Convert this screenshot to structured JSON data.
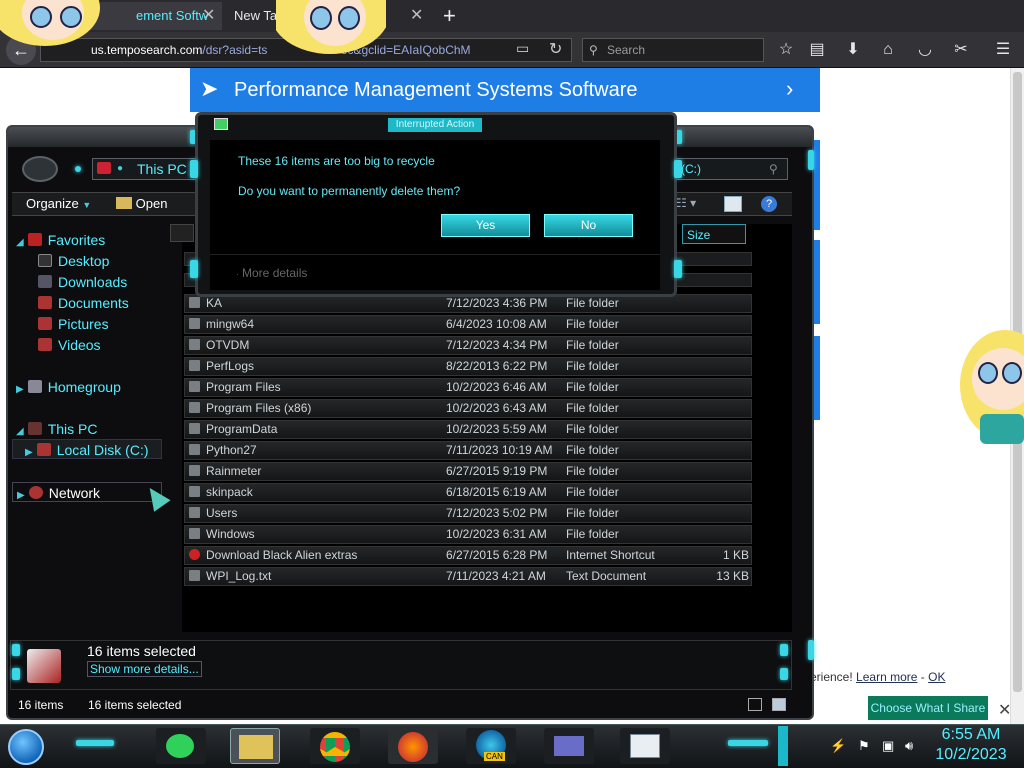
{
  "browser": {
    "tabs": [
      {
        "label": "ement Softw"
      },
      {
        "label": "New Tab"
      }
    ],
    "new_tab_icon": "plus-icon",
    "url_prefix": "https://",
    "url_domain": "us.temposearch.com",
    "url_rest": "/dsr?asid=ts",
    "url_tail": "ec&gclid=EAIaIQobChM",
    "search_placeholder": "Search"
  },
  "webpage": {
    "banner_title": "Performance Management Systems Software",
    "notice_text": "erience!",
    "learn_more": "Learn more",
    "separator": "-",
    "ok": "OK",
    "share_button": "Choose What I Share",
    "accent": "#1e7ee6"
  },
  "explorer": {
    "address_label": "This PC",
    "address_right": "(C:)",
    "toolbar": {
      "organize": "Organize",
      "open": "Open"
    },
    "column_size": "Size",
    "nav": {
      "favorites": "Favorites",
      "desktop": "Desktop",
      "downloads": "Downloads",
      "documents": "Documents",
      "pictures": "Pictures",
      "videos": "Videos",
      "homegroup": "Homegroup",
      "this_pc": "This PC",
      "local_disk": "Local Disk (C:)",
      "network": "Network"
    },
    "files": [
      {
        "name": "KA",
        "date": "7/12/2023 4:36 PM",
        "type": "File folder",
        "size": ""
      },
      {
        "name": "mingw64",
        "date": "6/4/2023 10:08 AM",
        "type": "File folder",
        "size": ""
      },
      {
        "name": "OTVDM",
        "date": "7/12/2023 4:34 PM",
        "type": "File folder",
        "size": ""
      },
      {
        "name": "PerfLogs",
        "date": "8/22/2013 6:22 PM",
        "type": "File folder",
        "size": ""
      },
      {
        "name": "Program Files",
        "date": "10/2/2023 6:46 AM",
        "type": "File folder",
        "size": ""
      },
      {
        "name": "Program Files (x86)",
        "date": "10/2/2023 6:43 AM",
        "type": "File folder",
        "size": ""
      },
      {
        "name": "ProgramData",
        "date": "10/2/2023 5:59 AM",
        "type": "File folder",
        "size": ""
      },
      {
        "name": "Python27",
        "date": "7/11/2023 10:19 AM",
        "type": "File folder",
        "size": ""
      },
      {
        "name": "Rainmeter",
        "date": "6/27/2015 9:19 PM",
        "type": "File folder",
        "size": ""
      },
      {
        "name": "skinpack",
        "date": "6/18/2015 6:19 AM",
        "type": "File folder",
        "size": ""
      },
      {
        "name": "Users",
        "date": "7/12/2023 5:02 PM",
        "type": "File folder",
        "size": ""
      },
      {
        "name": "Windows",
        "date": "10/2/2023 6:31 AM",
        "type": "File folder",
        "size": ""
      },
      {
        "name": "Download Black Alien extras",
        "date": "6/27/2015 6:28 PM",
        "type": "Internet Shortcut",
        "size": "1 KB"
      },
      {
        "name": "WPI_Log.txt",
        "date": "7/11/2023 4:21 AM",
        "type": "Text Document",
        "size": "13 KB"
      }
    ],
    "details": {
      "selected": "16 items selected",
      "show_more": "Show more details..."
    },
    "status": {
      "items": "16 items",
      "selected": "16 items selected"
    }
  },
  "dialog": {
    "title": "Interrupted Action",
    "message": "These 16 items are too big to recycle",
    "question": "Do you want to permanently delete them?",
    "yes": "Yes",
    "no": "No",
    "more_details": "More details"
  },
  "taskbar": {
    "time": "6:55 AM",
    "date": "10/2/2023",
    "edge_badge": "CAN"
  }
}
